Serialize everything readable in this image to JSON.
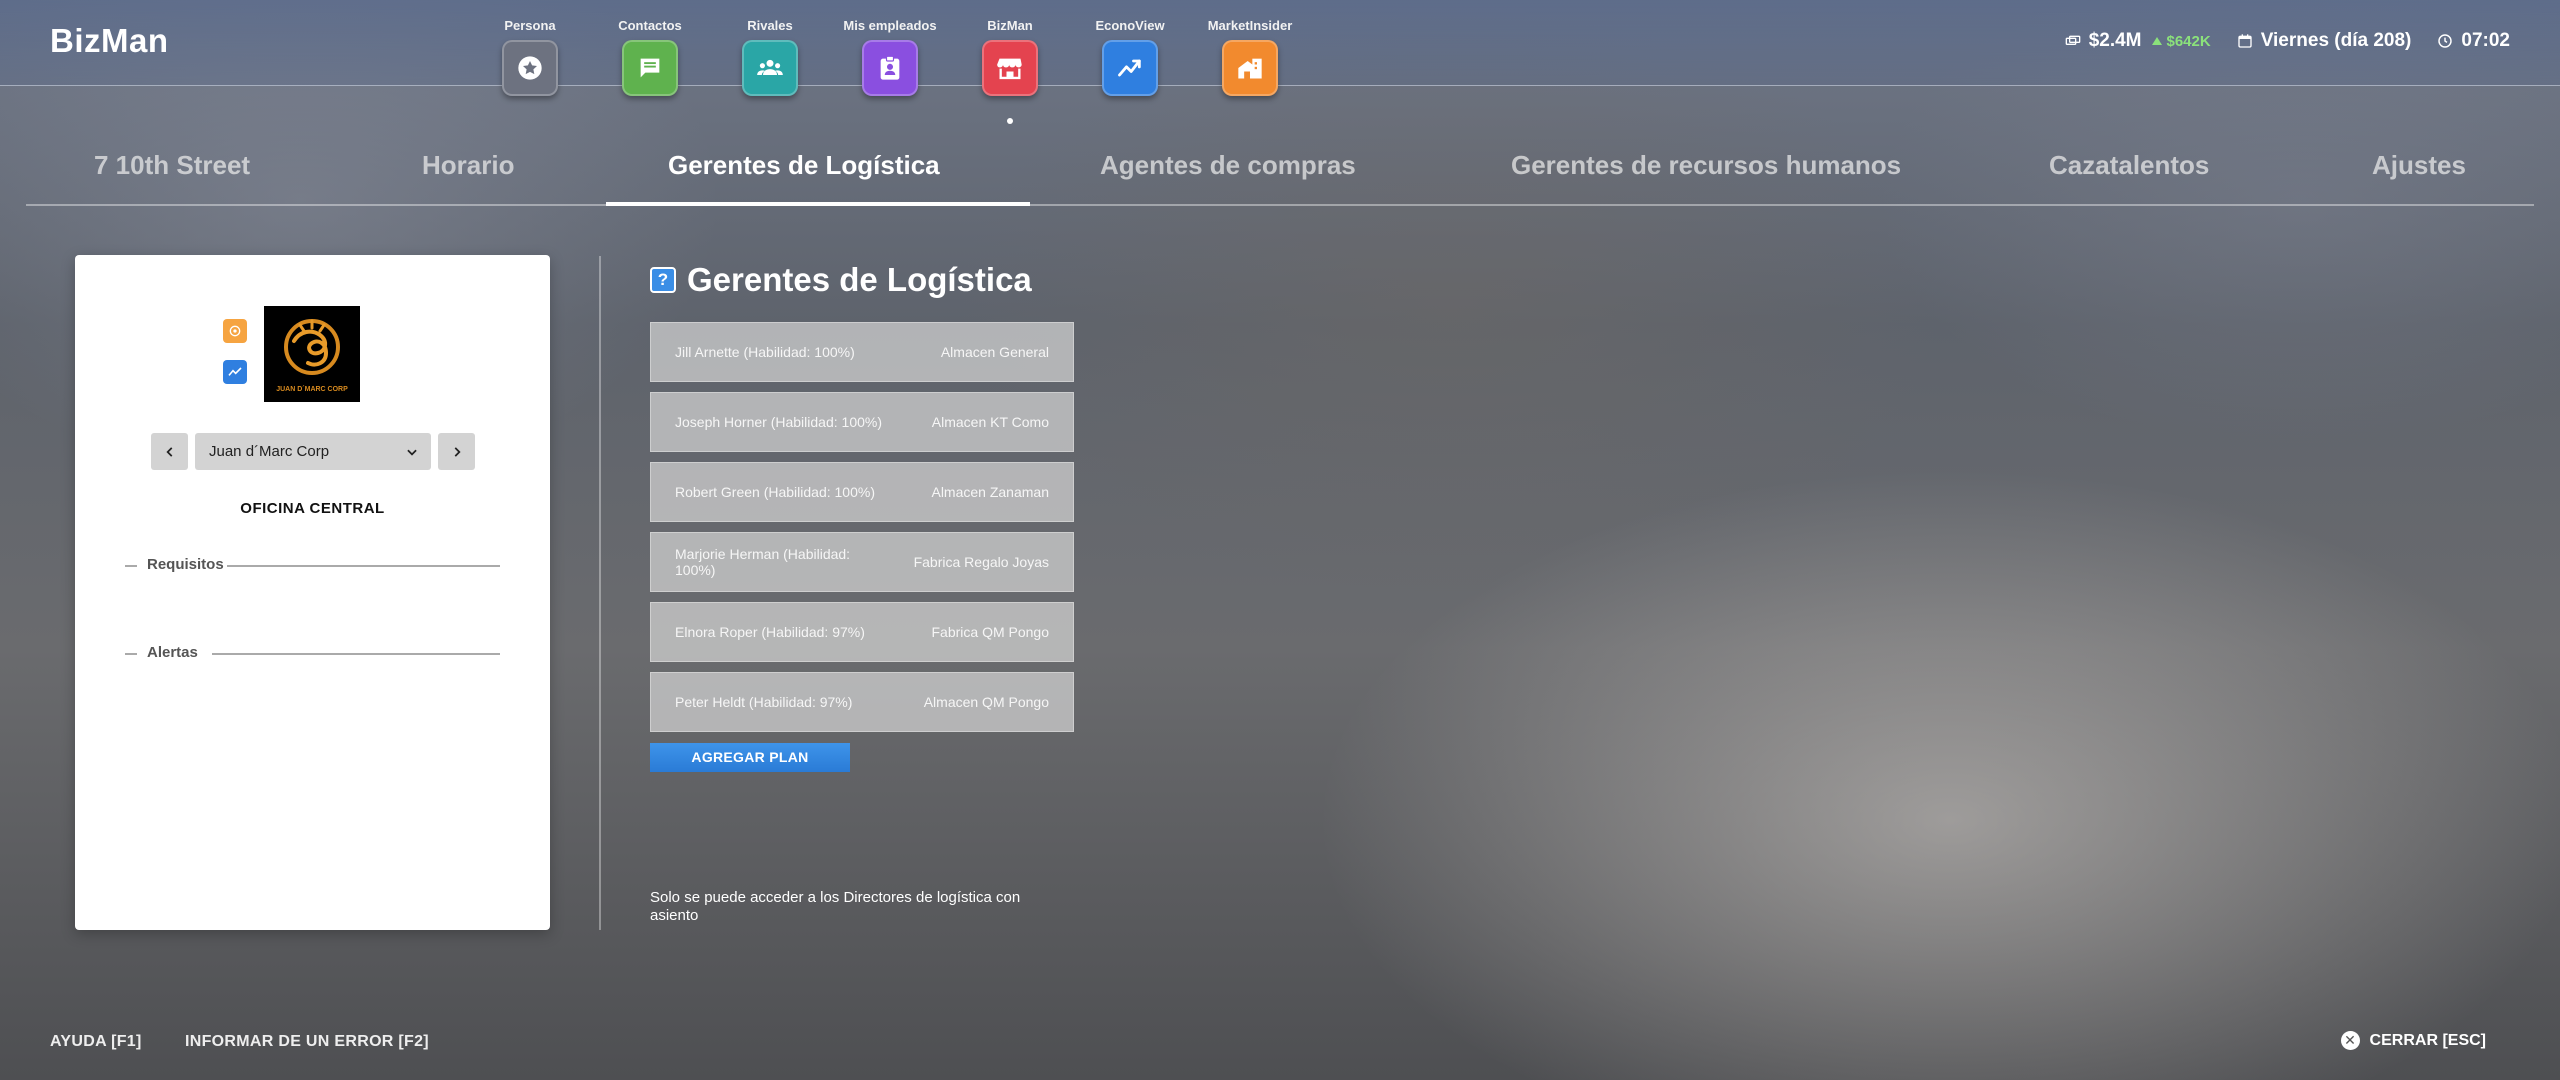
{
  "app": {
    "title": "BizMan"
  },
  "apps": [
    {
      "label": "Persona",
      "icon": "star-badge-icon",
      "color": "#6d7280"
    },
    {
      "label": "Contactos",
      "icon": "chat-icon",
      "color": "#5fb24e"
    },
    {
      "label": "Rivales",
      "icon": "group-icon",
      "color": "#2aa6a6"
    },
    {
      "label": "Mis empleados",
      "icon": "id-badge-icon",
      "color": "#8a4fe0"
    },
    {
      "label": "BizMan",
      "icon": "store-icon",
      "color": "#e4434f"
    },
    {
      "label": "EconoView",
      "icon": "trend-icon",
      "color": "#2f7fe0"
    },
    {
      "label": "MarketInsider",
      "icon": "building-icon",
      "color": "#f28a2e"
    }
  ],
  "status": {
    "money": "$2.4M",
    "money_delta": "$642K",
    "day": "Viernes (día 208)",
    "time": "07:02",
    "delta_color": "#8be27b"
  },
  "tabs": [
    {
      "label": "7 10th Street"
    },
    {
      "label": "Horario"
    },
    {
      "label": "Gerentes de Logística",
      "active": true
    },
    {
      "label": "Agentes de compras"
    },
    {
      "label": "Gerentes de recursos humanos"
    },
    {
      "label": "Cazatalentos"
    },
    {
      "label": "Ajustes"
    }
  ],
  "card": {
    "company": "Juan d´Marc Corp",
    "office": "OFICINA CENTRAL",
    "requirements_label": "Requisitos",
    "alerts_label": "Alertas",
    "logo_text": "JUAN D´MARC CORP"
  },
  "main": {
    "help": "?",
    "title": "Gerentes de Logística",
    "managers": [
      {
        "name": "Jill Arnette (Habilidad: 100%)",
        "location": "Almacen General"
      },
      {
        "name": "Joseph Horner (Habilidad: 100%)",
        "location": "Almacen KT Como"
      },
      {
        "name": "Robert Green (Habilidad: 100%)",
        "location": "Almacen Zanaman"
      },
      {
        "name": "Marjorie Herman (Habilidad: 100%)",
        "location": "Fabrica Regalo Joyas"
      },
      {
        "name": "Elnora Roper (Habilidad: 97%)",
        "location": "Fabrica QM Pongo"
      },
      {
        "name": "Peter Heldt (Habilidad: 97%)",
        "location": "Almacen QM Pongo"
      }
    ],
    "add_plan": "AGREGAR PLAN",
    "note": "Solo se puede acceder a los Directores de logística con asiento"
  },
  "footer": {
    "help": "AYUDA [F1]",
    "report": "INFORMAR DE UN ERROR [F2]",
    "close": "CERRAR [ESC]"
  }
}
